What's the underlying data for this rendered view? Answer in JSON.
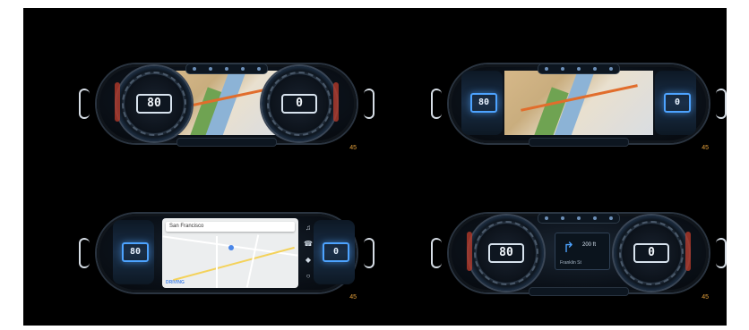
{
  "screens": [
    {
      "id": "cluster-dual-gauge-map",
      "left_gauge_value": "80",
      "right_gauge_value": "0",
      "status_label": "45"
    },
    {
      "id": "cluster-fullmap",
      "left_tile_value": "80",
      "right_tile_value": "0",
      "status_label": "45"
    },
    {
      "id": "cluster-android-auto",
      "search_placeholder": "San Francisco",
      "left_tile_value": "80",
      "right_tile_value": "0",
      "footer_label": "DRIVING",
      "status_label": "45"
    },
    {
      "id": "cluster-dual-gauge-nav",
      "left_gauge_value": "80",
      "right_gauge_value": "0",
      "nav_distance": "200 ft",
      "nav_street": "Franklin St",
      "status_label": "45"
    }
  ],
  "colors": {
    "accent": "#4da3ff",
    "warning": "#e6a23c",
    "redzone": "#b33a2a",
    "background": "#000000"
  }
}
